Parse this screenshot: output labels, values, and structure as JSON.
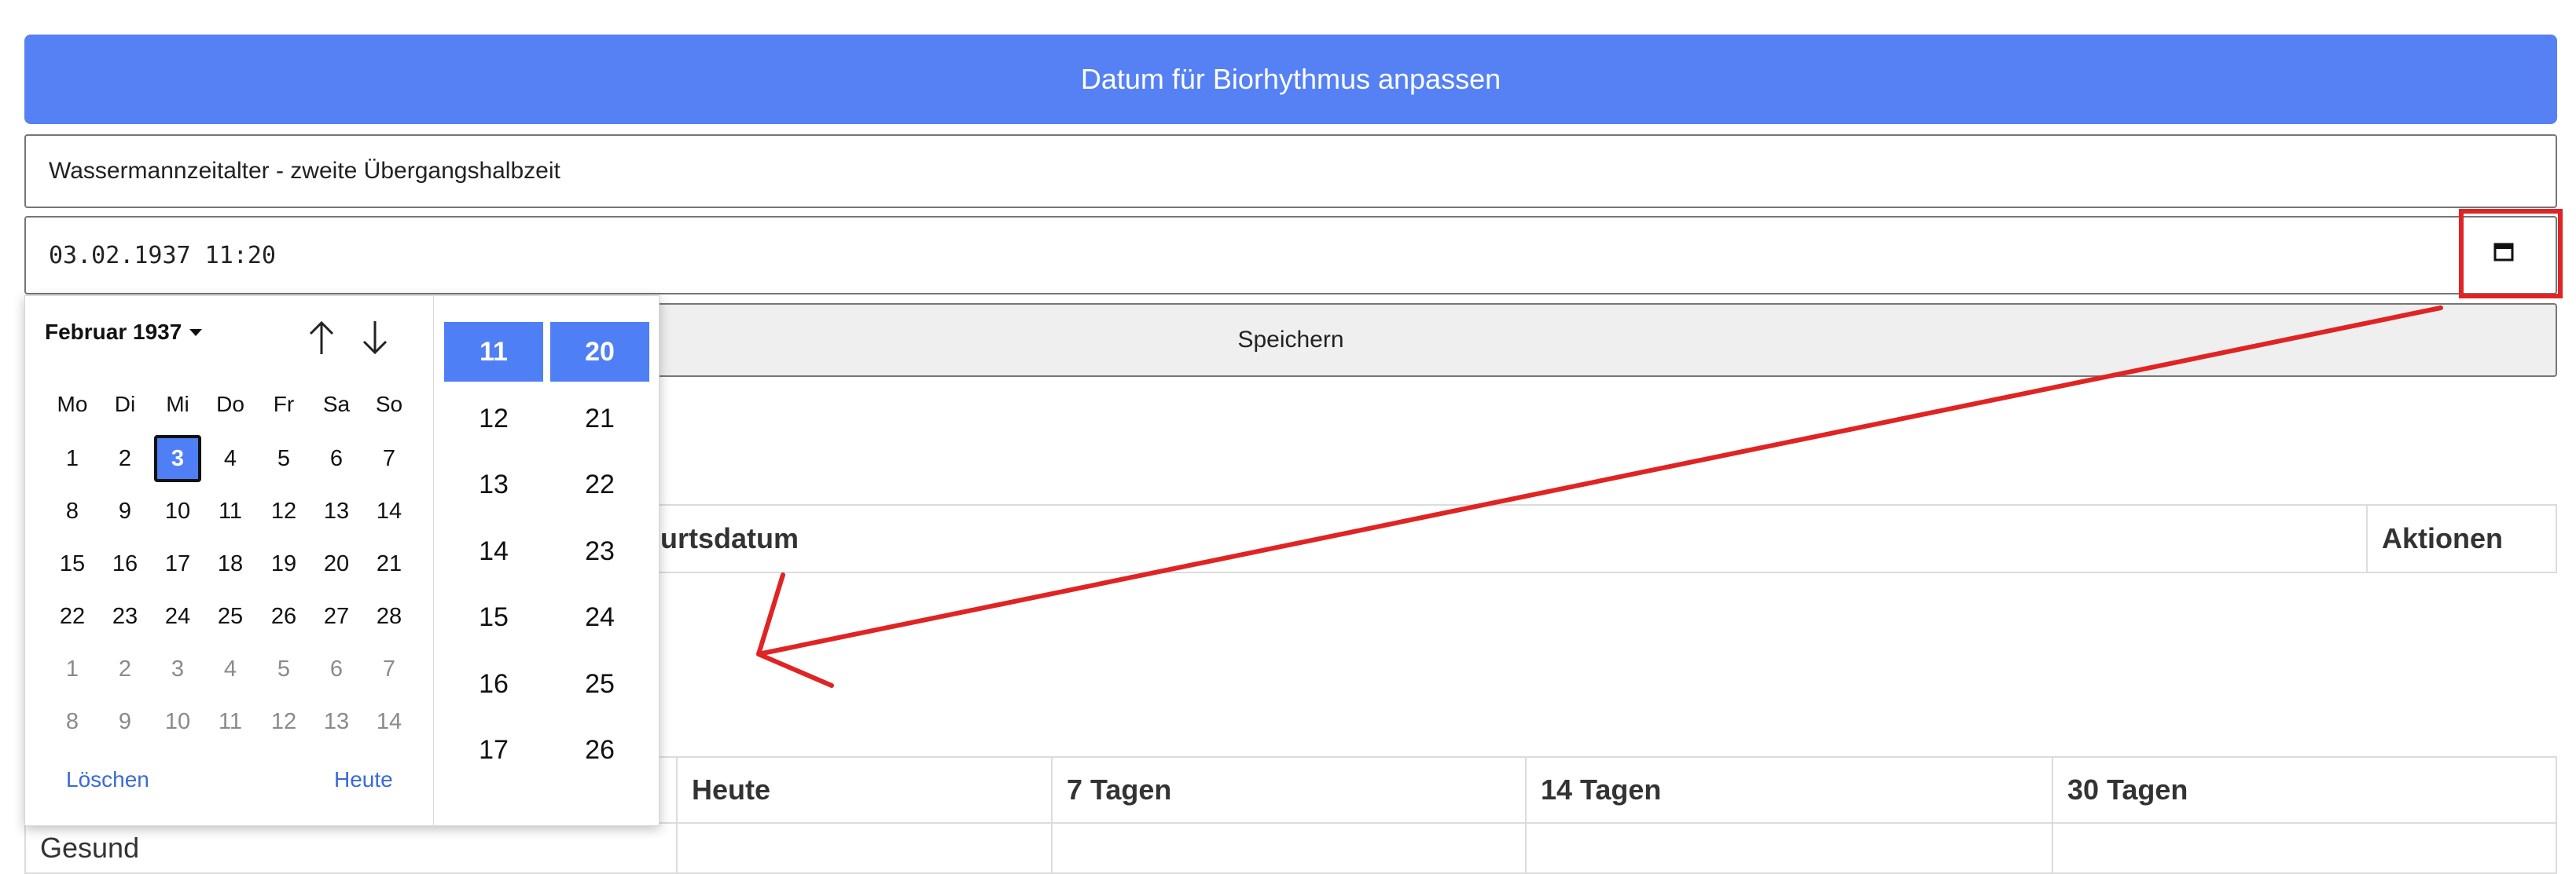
{
  "header": {
    "button_label": "Datum für Biorhythmus anpassen"
  },
  "form": {
    "name_value": "Wassermannzeitalter - zweite Übergangshalbzeit",
    "datetime_value": "03.02.1937 11:20",
    "save_label": "Speichern"
  },
  "people_table": {
    "col_birth_partial": "burtsdatum",
    "col_actions": "Aktionen"
  },
  "bio_table": {
    "headers": [
      "",
      "Heute",
      "7 Tagen",
      "14 Tagen",
      "30 Tagen"
    ],
    "first_row_label_partial": "Gesund"
  },
  "picker": {
    "month_label": "Februar 1937",
    "weekdays": [
      "Mo",
      "Di",
      "Mi",
      "Do",
      "Fr",
      "Sa",
      "So"
    ],
    "weeks": [
      [
        "1",
        "2",
        "3",
        "4",
        "5",
        "6",
        "7"
      ],
      [
        "8",
        "9",
        "10",
        "11",
        "12",
        "13",
        "14"
      ],
      [
        "15",
        "16",
        "17",
        "18",
        "19",
        "20",
        "21"
      ],
      [
        "22",
        "23",
        "24",
        "25",
        "26",
        "27",
        "28"
      ],
      [
        "1",
        "2",
        "3",
        "4",
        "5",
        "6",
        "7"
      ],
      [
        "8",
        "9",
        "10",
        "11",
        "12",
        "13",
        "14"
      ]
    ],
    "other_month_weeks": [
      4,
      5
    ],
    "selected_day": "3",
    "clear_label": "Löschen",
    "today_label": "Heute",
    "hours": [
      "11",
      "12",
      "13",
      "14",
      "15",
      "16",
      "17"
    ],
    "minutes": [
      "20",
      "21",
      "22",
      "23",
      "24",
      "25",
      "26"
    ],
    "selected_hour": "11",
    "selected_minute": "20"
  },
  "icons": {
    "calendar": "calendar-icon",
    "prev": "arrow-up-icon",
    "next": "arrow-down-icon",
    "caret": "caret-down-icon"
  },
  "colors": {
    "accent": "#4f7ff4",
    "annotation": "#e02424"
  }
}
